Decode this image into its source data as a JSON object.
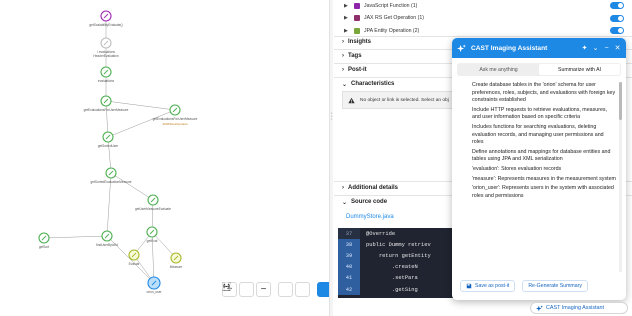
{
  "graph": {
    "nodes": [
      {
        "label": "getScalabilityEvaluate()",
        "sub": "",
        "kind": "method"
      },
      {
        "label": "/ evaluations",
        "sub": "",
        "kind": "endpoint"
      },
      {
        "label": "HeaderEvaluation",
        "sub": "",
        "kind": "resource"
      },
      {
        "label": "evaluations",
        "sub": "",
        "kind": "method"
      },
      {
        "label": "getEvaluationsForUserMeasure",
        "sub": "",
        "kind": "method"
      },
      {
        "label": "getEvaluationsForUserMeasure",
        "sub": "JAXRSGetOperation",
        "kind": "method"
      },
      {
        "label": "getSortedUser",
        "sub": "",
        "kind": "method"
      },
      {
        "label": "getSortedEvaluationMeasure",
        "sub": "",
        "kind": "method"
      },
      {
        "label": "getUserMeasureEvaluate",
        "sub": "",
        "kind": "method"
      },
      {
        "label": "getEval",
        "sub": "",
        "kind": "method"
      },
      {
        "label": "findUserById/Id",
        "sub": "",
        "kind": "method"
      },
      {
        "label": "getSort",
        "sub": "",
        "kind": "method"
      },
      {
        "label": "Evaluat",
        "sub": "",
        "kind": "table"
      },
      {
        "label": "Measure",
        "sub": "",
        "kind": "table"
      },
      {
        "label": "orion_user",
        "sub": "",
        "kind": "table-selected"
      }
    ],
    "toolbar": {
      "zoom_in": "+",
      "zoom_out": "−"
    }
  },
  "legend": [
    {
      "label": "JavaScript Function (1)",
      "color": "#8e24aa",
      "enabled": true
    },
    {
      "label": "JAX RS Get Operation (1)",
      "color": "#8e2f6a",
      "enabled": true
    },
    {
      "label": "JPA Entity Operation (2)",
      "color": "#7aa63c",
      "enabled": true
    }
  ],
  "sections": {
    "insights": "Insights",
    "tags": "Tags",
    "postit": "Post-it",
    "characteristics": "Characteristics",
    "notice": "No object or link is selected. Select an obj",
    "additional": "Additional details",
    "source": "Source code",
    "file": "DummyStore.java"
  },
  "code": [
    {
      "line": "37",
      "text": "@Override"
    },
    {
      "line": "38",
      "text": "public Dummy retriev"
    },
    {
      "line": "39",
      "text": "    return getEntity"
    },
    {
      "line": "40",
      "text": "        .createN"
    },
    {
      "line": "41",
      "text": "        .setPara"
    },
    {
      "line": "42",
      "text": "        .getSing"
    }
  ],
  "assistant": {
    "title": "CAST Imaging Assistant",
    "tabs": [
      "Ask me anything",
      "Summarize with AI"
    ],
    "active_tab": 1,
    "bullets": [
      "Create database tables in the 'orion' schema for user preferences, roles, subjects, and evaluations with foreign key constraints established",
      "Include HTTP requests to retrieve evaluations, measures, and user information based on specific criteria",
      "Includes functions for searching evaluations, deleting evaluation records, and managing user permissions and roles",
      "Define annotations and mappings for database entities and tables using JPA and XML serialization",
      "'evaluation': Stores evaluation records",
      "'measure': Represents measures in the measurement system",
      "'orion_user': Represents users in the system with associated roles and permissions"
    ],
    "save_label": "Save as post-it",
    "regen_label": "Re-Generate Summary"
  },
  "fab_label": "CAST Imaging Assistant",
  "colors": {
    "accent": "#1e88e5",
    "node_green": "#4caf50",
    "node_purple": "#9c27b0",
    "node_yellow": "#cddc39"
  }
}
